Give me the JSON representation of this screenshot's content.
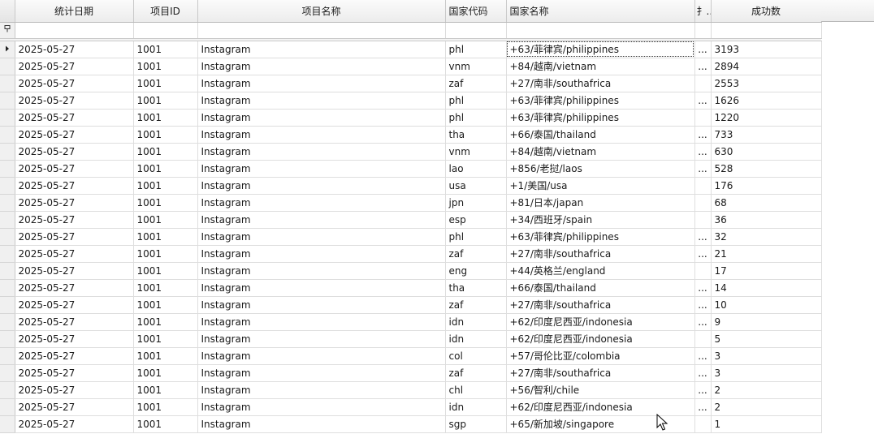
{
  "columns": [
    {
      "key": "indicator",
      "label": ""
    },
    {
      "key": "date",
      "label": "统计日期"
    },
    {
      "key": "project_id",
      "label": "项目ID"
    },
    {
      "key": "project_name",
      "label": "项目名称"
    },
    {
      "key": "country_code",
      "label": "国家代码"
    },
    {
      "key": "country_name",
      "label": "国家名称"
    },
    {
      "key": "truncated",
      "label": "扌.."
    },
    {
      "key": "success",
      "label": "成功数"
    }
  ],
  "filter_row_icon": "filter-pin-icon",
  "focused_row_icon": "row-pointer-icon",
  "ellipsis": "...",
  "rows": [
    {
      "date": "2025-05-27",
      "project_id": "1001",
      "project_name": "Instagram",
      "country_code": "phl",
      "country_name": "+63/菲律宾/philippines",
      "truncated": "...",
      "success": "3193"
    },
    {
      "date": "2025-05-27",
      "project_id": "1001",
      "project_name": "Instagram",
      "country_code": "vnm",
      "country_name": "+84/越南/vietnam",
      "truncated": "...",
      "success": "2894"
    },
    {
      "date": "2025-05-27",
      "project_id": "1001",
      "project_name": "Instagram",
      "country_code": "zaf",
      "country_name": "+27/南非/southafrica",
      "truncated": "",
      "success": "2553"
    },
    {
      "date": "2025-05-27",
      "project_id": "1001",
      "project_name": "Instagram",
      "country_code": "phl",
      "country_name": "+63/菲律宾/philippines",
      "truncated": "...",
      "success": "1626"
    },
    {
      "date": "2025-05-27",
      "project_id": "1001",
      "project_name": "Instagram",
      "country_code": "phl",
      "country_name": "+63/菲律宾/philippines",
      "truncated": "",
      "success": "1220"
    },
    {
      "date": "2025-05-27",
      "project_id": "1001",
      "project_name": "Instagram",
      "country_code": "tha",
      "country_name": "+66/泰国/thailand",
      "truncated": "...",
      "success": "733"
    },
    {
      "date": "2025-05-27",
      "project_id": "1001",
      "project_name": "Instagram",
      "country_code": "vnm",
      "country_name": "+84/越南/vietnam",
      "truncated": "...",
      "success": "630"
    },
    {
      "date": "2025-05-27",
      "project_id": "1001",
      "project_name": "Instagram",
      "country_code": "lao",
      "country_name": "+856/老挝/laos",
      "truncated": "...",
      "success": "528"
    },
    {
      "date": "2025-05-27",
      "project_id": "1001",
      "project_name": "Instagram",
      "country_code": "usa",
      "country_name": "+1/美国/usa",
      "truncated": "",
      "success": "176"
    },
    {
      "date": "2025-05-27",
      "project_id": "1001",
      "project_name": "Instagram",
      "country_code": "jpn",
      "country_name": "+81/日本/japan",
      "truncated": "",
      "success": "68"
    },
    {
      "date": "2025-05-27",
      "project_id": "1001",
      "project_name": "Instagram",
      "country_code": "esp",
      "country_name": "+34/西班牙/spain",
      "truncated": "",
      "success": "36"
    },
    {
      "date": "2025-05-27",
      "project_id": "1001",
      "project_name": "Instagram",
      "country_code": "phl",
      "country_name": "+63/菲律宾/philippines",
      "truncated": "...",
      "success": "32"
    },
    {
      "date": "2025-05-27",
      "project_id": "1001",
      "project_name": "Instagram",
      "country_code": "zaf",
      "country_name": "+27/南非/southafrica",
      "truncated": "...",
      "success": "21"
    },
    {
      "date": "2025-05-27",
      "project_id": "1001",
      "project_name": "Instagram",
      "country_code": "eng",
      "country_name": "+44/英格兰/england",
      "truncated": "",
      "success": "17"
    },
    {
      "date": "2025-05-27",
      "project_id": "1001",
      "project_name": "Instagram",
      "country_code": "tha",
      "country_name": "+66/泰国/thailand",
      "truncated": "...",
      "success": "14"
    },
    {
      "date": "2025-05-27",
      "project_id": "1001",
      "project_name": "Instagram",
      "country_code": "zaf",
      "country_name": "+27/南非/southafrica",
      "truncated": "...",
      "success": "10"
    },
    {
      "date": "2025-05-27",
      "project_id": "1001",
      "project_name": "Instagram",
      "country_code": "idn",
      "country_name": "+62/印度尼西亚/indonesia",
      "truncated": "...",
      "success": "9"
    },
    {
      "date": "2025-05-27",
      "project_id": "1001",
      "project_name": "Instagram",
      "country_code": "idn",
      "country_name": "+62/印度尼西亚/indonesia",
      "truncated": "",
      "success": "5"
    },
    {
      "date": "2025-05-27",
      "project_id": "1001",
      "project_name": "Instagram",
      "country_code": "col",
      "country_name": "+57/哥伦比亚/colombia",
      "truncated": "...",
      "success": "3"
    },
    {
      "date": "2025-05-27",
      "project_id": "1001",
      "project_name": "Instagram",
      "country_code": "zaf",
      "country_name": "+27/南非/southafrica",
      "truncated": "...",
      "success": "3"
    },
    {
      "date": "2025-05-27",
      "project_id": "1001",
      "project_name": "Instagram",
      "country_code": "chl",
      "country_name": "+56/智利/chile",
      "truncated": "...",
      "success": "2"
    },
    {
      "date": "2025-05-27",
      "project_id": "1001",
      "project_name": "Instagram",
      "country_code": "idn",
      "country_name": "+62/印度尼西亚/indonesia",
      "truncated": "...",
      "success": "2"
    },
    {
      "date": "2025-05-27",
      "project_id": "1001",
      "project_name": "Instagram",
      "country_code": "sgp",
      "country_name": "+65/新加坡/singapore",
      "truncated": "",
      "success": "1"
    }
  ]
}
